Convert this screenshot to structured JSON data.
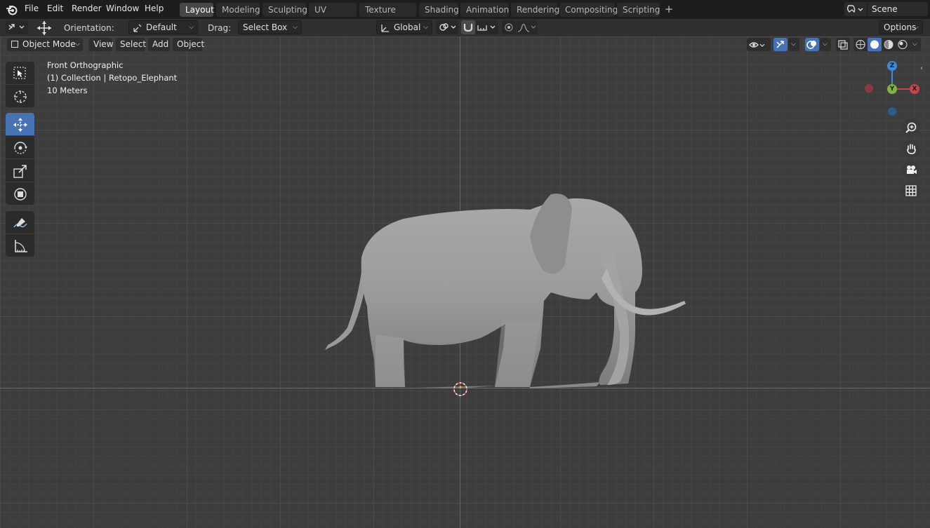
{
  "topbar": {
    "menus": [
      "File",
      "Edit",
      "Render",
      "Window",
      "Help"
    ],
    "workspaces": [
      "Layout",
      "Modeling",
      "Sculpting",
      "UV Editing",
      "Texture Paint",
      "Shading",
      "Animation",
      "Rendering",
      "Compositing",
      "Scripting"
    ],
    "active_workspace": "Layout",
    "add_workspace": "+",
    "scene_name": "Scene"
  },
  "header": {
    "orientation_label": "Orientation:",
    "orientation_value": "Default",
    "drag_label": "Drag:",
    "drag_value": "Select Box",
    "transform_orientation": "Global",
    "options_label": "Options"
  },
  "viewport_header": {
    "mode": "Object Mode",
    "view": "View",
    "select": "Select",
    "add": "Add",
    "object": "Object"
  },
  "viewport_info": {
    "view_name": "Front Orthographic",
    "collection_object": "(1) Collection | Retopo_Elephant",
    "scale": "10 Meters"
  },
  "gizmo": {
    "z": "Z",
    "y": "Y",
    "x": "X"
  },
  "colors": {
    "accent": "#4772b3",
    "x_axis": "#c8434a",
    "y_axis": "#7fb342",
    "z_axis": "#3f8ad6"
  },
  "tools": [
    "select-box-icon",
    "cursor-icon",
    "move-icon",
    "rotate-icon",
    "scale-icon",
    "transform-icon",
    "annotate-icon",
    "measure-icon"
  ]
}
